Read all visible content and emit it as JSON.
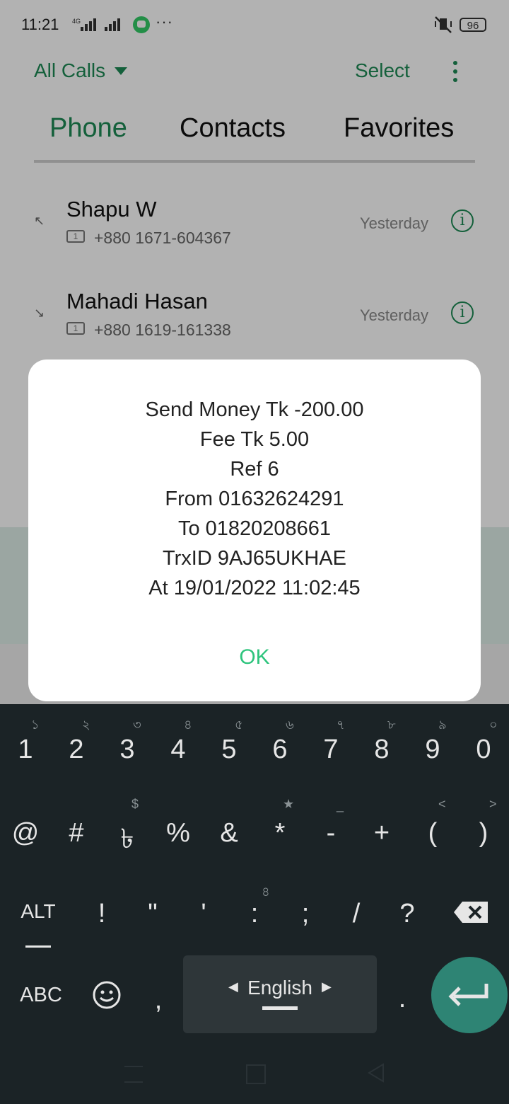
{
  "status_bar": {
    "time": "11:21",
    "battery": "96"
  },
  "header": {
    "filter_label": "All Calls",
    "select_label": "Select"
  },
  "tabs": [
    {
      "label": "Phone"
    },
    {
      "label": "Contacts"
    },
    {
      "label": "Favorites"
    }
  ],
  "calls": [
    {
      "name": "Shapu W",
      "sim": "1",
      "number": "+880 1671-604367",
      "when": "Yesterday"
    },
    {
      "name": "Mahadi Hasan",
      "sim": "1",
      "number": "+880 1619-161338",
      "when": "Yesterday"
    }
  ],
  "dialog": {
    "lines": [
      "Send Money Tk -200.00",
      "Fee Tk 5.00",
      "Ref 6",
      "From 01632624291",
      "To 01820208661",
      "TrxID 9AJ65UKHAE",
      "At 19/01/2022 11:02:45"
    ],
    "ok_label": "OK"
  },
  "keyboard": {
    "row1": [
      {
        "main": "1",
        "hint": "১"
      },
      {
        "main": "2",
        "hint": "২"
      },
      {
        "main": "3",
        "hint": "৩"
      },
      {
        "main": "4",
        "hint": "৪"
      },
      {
        "main": "5",
        "hint": "৫"
      },
      {
        "main": "6",
        "hint": "৬"
      },
      {
        "main": "7",
        "hint": "৭"
      },
      {
        "main": "8",
        "hint": "৮"
      },
      {
        "main": "9",
        "hint": "৯"
      },
      {
        "main": "0",
        "hint": "০"
      }
    ],
    "row2": [
      {
        "main": "@",
        "hint": ""
      },
      {
        "main": "#",
        "hint": ""
      },
      {
        "main": "৳",
        "hint": "$"
      },
      {
        "main": "%",
        "hint": ""
      },
      {
        "main": "&",
        "hint": ""
      },
      {
        "main": "*",
        "hint": "★"
      },
      {
        "main": "-",
        "hint": "_"
      },
      {
        "main": "+",
        "hint": ""
      },
      {
        "main": "(",
        "hint": "<"
      },
      {
        "main": ")",
        "hint": ">"
      }
    ],
    "row3": [
      {
        "main": "ALT",
        "hint": ""
      },
      {
        "main": "!",
        "hint": ""
      },
      {
        "main": "\"",
        "hint": ""
      },
      {
        "main": "'",
        "hint": ""
      },
      {
        "main": ":",
        "hint": "৪"
      },
      {
        "main": ";",
        "hint": ""
      },
      {
        "main": "/",
        "hint": ""
      },
      {
        "main": "?",
        "hint": ""
      }
    ],
    "abc_label": "ABC",
    "comma": ",",
    "period": ".",
    "language": "English"
  },
  "colors": {
    "accent": "#1e8a55",
    "ok_text": "#2ec47d",
    "keyboard_bg": "#1b2326",
    "enter_key": "#2e8474"
  }
}
